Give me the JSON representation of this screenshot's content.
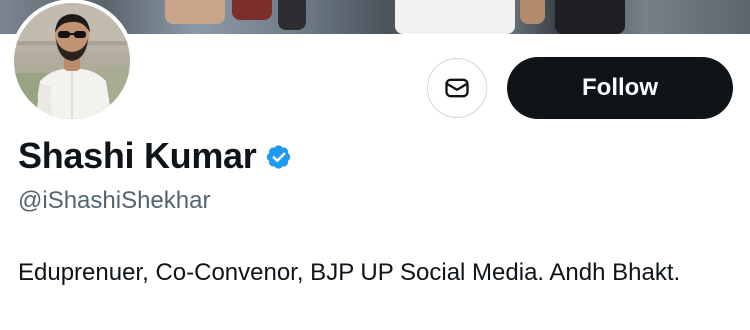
{
  "profile": {
    "display_name": "Shashi Kumar",
    "handle": "@iShashiShekhar",
    "verified": true,
    "bio": "Eduprenuer, Co-Convenor, BJP UP Social Media. Andh Bhakt."
  },
  "actions": {
    "message_icon": "envelope-icon",
    "follow_label": "Follow"
  },
  "colors": {
    "primary_text": "#0f1419",
    "secondary_text": "#536471",
    "verified_badge": "#1d9bf0",
    "follow_button_bg": "#0f1419",
    "follow_button_text": "#ffffff",
    "button_border": "#cfd9de"
  }
}
